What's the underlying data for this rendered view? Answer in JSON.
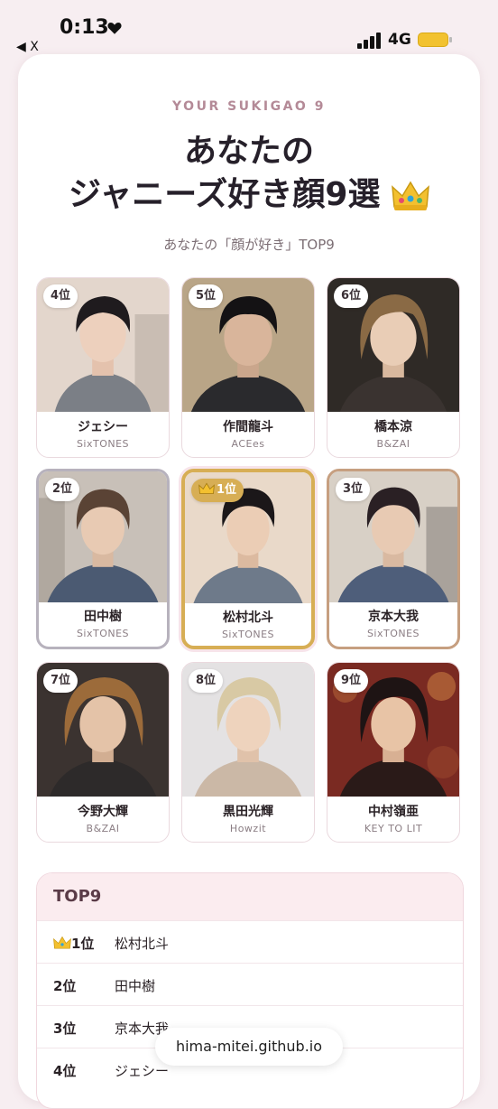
{
  "status": {
    "time": "0:13",
    "back_label": "◀ X",
    "network": "4G"
  },
  "header": {
    "eyebrow": "YOUR SUKIGAO 9",
    "title_line1": "あなたの",
    "title_line2": "ジャニーズ好き顔9選",
    "subtitle": "あなたの「顔が好き」TOP9"
  },
  "grid": [
    {
      "rank": "4位",
      "name": "ジェシー",
      "group": "SixTONES"
    },
    {
      "rank": "5位",
      "name": "作間龍斗",
      "group": "ACEes"
    },
    {
      "rank": "6位",
      "name": "橋本涼",
      "group": "B&ZAI"
    },
    {
      "rank": "2位",
      "name": "田中樹",
      "group": "SixTONES"
    },
    {
      "rank": "1位",
      "name": "松村北斗",
      "group": "SixTONES"
    },
    {
      "rank": "3位",
      "name": "京本大我",
      "group": "SixTONES"
    },
    {
      "rank": "7位",
      "name": "今野大輝",
      "group": "B&ZAI"
    },
    {
      "rank": "8位",
      "name": "黒田光輝",
      "group": "Howzit"
    },
    {
      "rank": "9位",
      "name": "中村嶺亜",
      "group": "KEY TO LIT"
    }
  ],
  "toplist": {
    "heading": "TOP9",
    "rows": [
      {
        "rank": "1位",
        "name": "松村北斗"
      },
      {
        "rank": "2位",
        "name": "田中樹"
      },
      {
        "rank": "3位",
        "name": "京本大我"
      },
      {
        "rank": "4位",
        "name": "ジェシー"
      }
    ]
  },
  "url": "hima-mitei.github.io",
  "colors": {
    "gold": "#d7ae55",
    "silver": "#b7b2bd",
    "bronze": "#c69f80",
    "eyebrow": "#b48a97"
  },
  "icons": [
    "heart-icon",
    "signal-icon",
    "battery-icon",
    "crown-icon"
  ]
}
